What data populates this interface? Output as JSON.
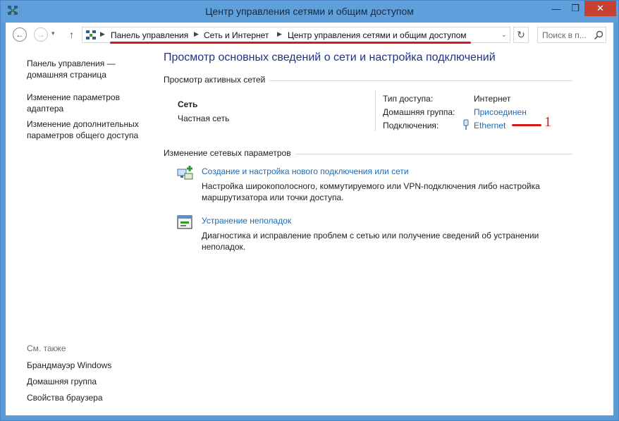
{
  "window": {
    "title": "Центр управления сетями и общим доступом",
    "min_glyph": "—",
    "max_glyph": "❐",
    "close_glyph": "✕"
  },
  "nav": {
    "back_icon": "←",
    "forward_icon": "→",
    "dropdown_icon": "▾",
    "up_icon": "↑",
    "refresh_icon": "↻"
  },
  "address": {
    "crumbs": [
      "Панель управления",
      "Сеть и Интернет",
      "Центр управления сетями и общим доступом"
    ],
    "sep_icon": "▶",
    "dropdown_icon": "⌄"
  },
  "search": {
    "placeholder": "Поиск в п..."
  },
  "sidebar": {
    "links": [
      "Панель управления — домашняя страница",
      "Изменение параметров адаптера",
      "Изменение дополнительных параметров общего доступа"
    ],
    "see_also": "См. также",
    "see_also_links": [
      "Брандмауэр Windows",
      "Домашняя группа",
      "Свойства браузера"
    ]
  },
  "main": {
    "heading": "Просмотр основных сведений о сети и настройка подключений",
    "active_title": "Просмотр активных сетей",
    "network": {
      "name": "Сеть",
      "type": "Частная сеть",
      "access_label": "Тип доступа:",
      "access_value": "Интернет",
      "homegroup_label": "Домашняя группа:",
      "homegroup_value": "Присоединен",
      "connections_label": "Подключения:",
      "connections_value": "Ethernet"
    },
    "change_title": "Изменение сетевых параметров",
    "tasks": [
      {
        "title": "Создание и настройка нового подключения или сети",
        "desc": "Настройка широкополосного, коммутируемого или VPN-подключения либо настройка маршрутизатора или точки доступа."
      },
      {
        "title": "Устранение неполадок",
        "desc": "Диагностика и исправление проблем с сетью или получение сведений об устранении неполадок."
      }
    ]
  },
  "annotation": {
    "number": "1"
  },
  "colors": {
    "titlebar": "#5f9fdc",
    "link": "#1a6bb5",
    "heading": "#1e3287",
    "annotation": "#d11a1a",
    "close": "#c84031"
  }
}
